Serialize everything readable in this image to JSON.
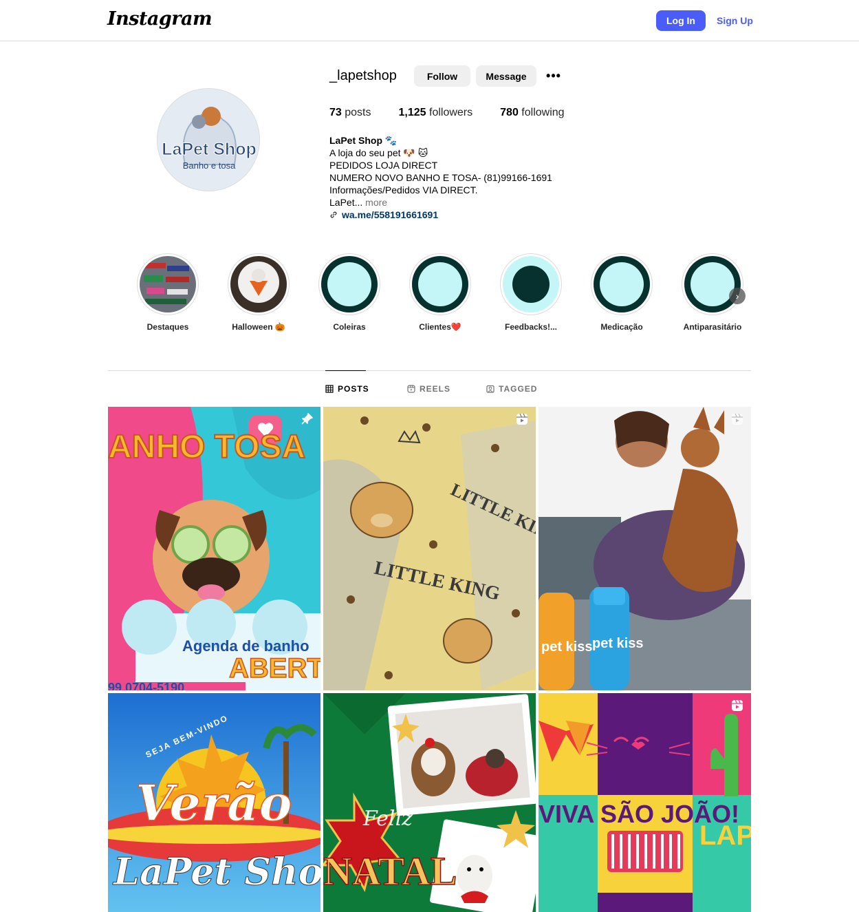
{
  "nav": {
    "brand": "Instagram",
    "login_label": "Log In",
    "signup_label": "Sign Up"
  },
  "profile": {
    "username": "_lapetshop",
    "follow_label": "Follow",
    "message_label": "Message",
    "more_label": "•••",
    "avatar_brand": "LaPet Shop",
    "avatar_tagline": "Banho e tosa",
    "stats": {
      "posts_count": "73",
      "posts_label": "posts",
      "followers_count": "1,125",
      "followers_label": "followers",
      "following_count": "780",
      "following_label": "following"
    },
    "bio": {
      "full_name": "LaPet Shop 🐾",
      "line1": "A loja do seu pet 🐶 🐱",
      "line2": "PEDIDOS LOJA DIRECT",
      "line3": "NUMERO NOVO BANHO E TOSA- (81)99166-1691",
      "line4": "Informações/Pedidos VIA DIRECT.",
      "line5": "LaPet...",
      "more_label": "more",
      "link": "wa.me/558191661691"
    }
  },
  "highlights": [
    {
      "label": "Destaques"
    },
    {
      "label": "Halloween 🎃"
    },
    {
      "label": "Coleiras"
    },
    {
      "label": "Clientes❤️"
    },
    {
      "label": "Feedbacks!..."
    },
    {
      "label": "Medicação"
    },
    {
      "label": "Antiparasitário"
    }
  ],
  "tabs": {
    "posts": "POSTS",
    "reels": "REELS",
    "tagged": "TAGGED"
  },
  "posts": {
    "p1_title": "ANHO TOSA",
    "p1_caption": "Agenda de banho",
    "p1_sub": "ABERT",
    "p1_phone": "99 0704-5190",
    "p2_text1": "LITTLE KING",
    "p2_text2": "LITTLE KING",
    "p3_brand1": "pet kiss",
    "p3_brand2": "pet kiss",
    "p4_top": "SEJA BEM-VINDO",
    "p4_title": "Verão",
    "p4_sub": "LaPet Shop",
    "p5_feliz": "Feliz",
    "p5_title": "NATAL",
    "p6_text": "VIVA SÃO JOÃO!",
    "p6_brand": "LAPET SHOP"
  },
  "colors": {
    "accent": "#4a5df9",
    "highlight_dark": "#06312f",
    "highlight_light": "#c5f6f7"
  }
}
